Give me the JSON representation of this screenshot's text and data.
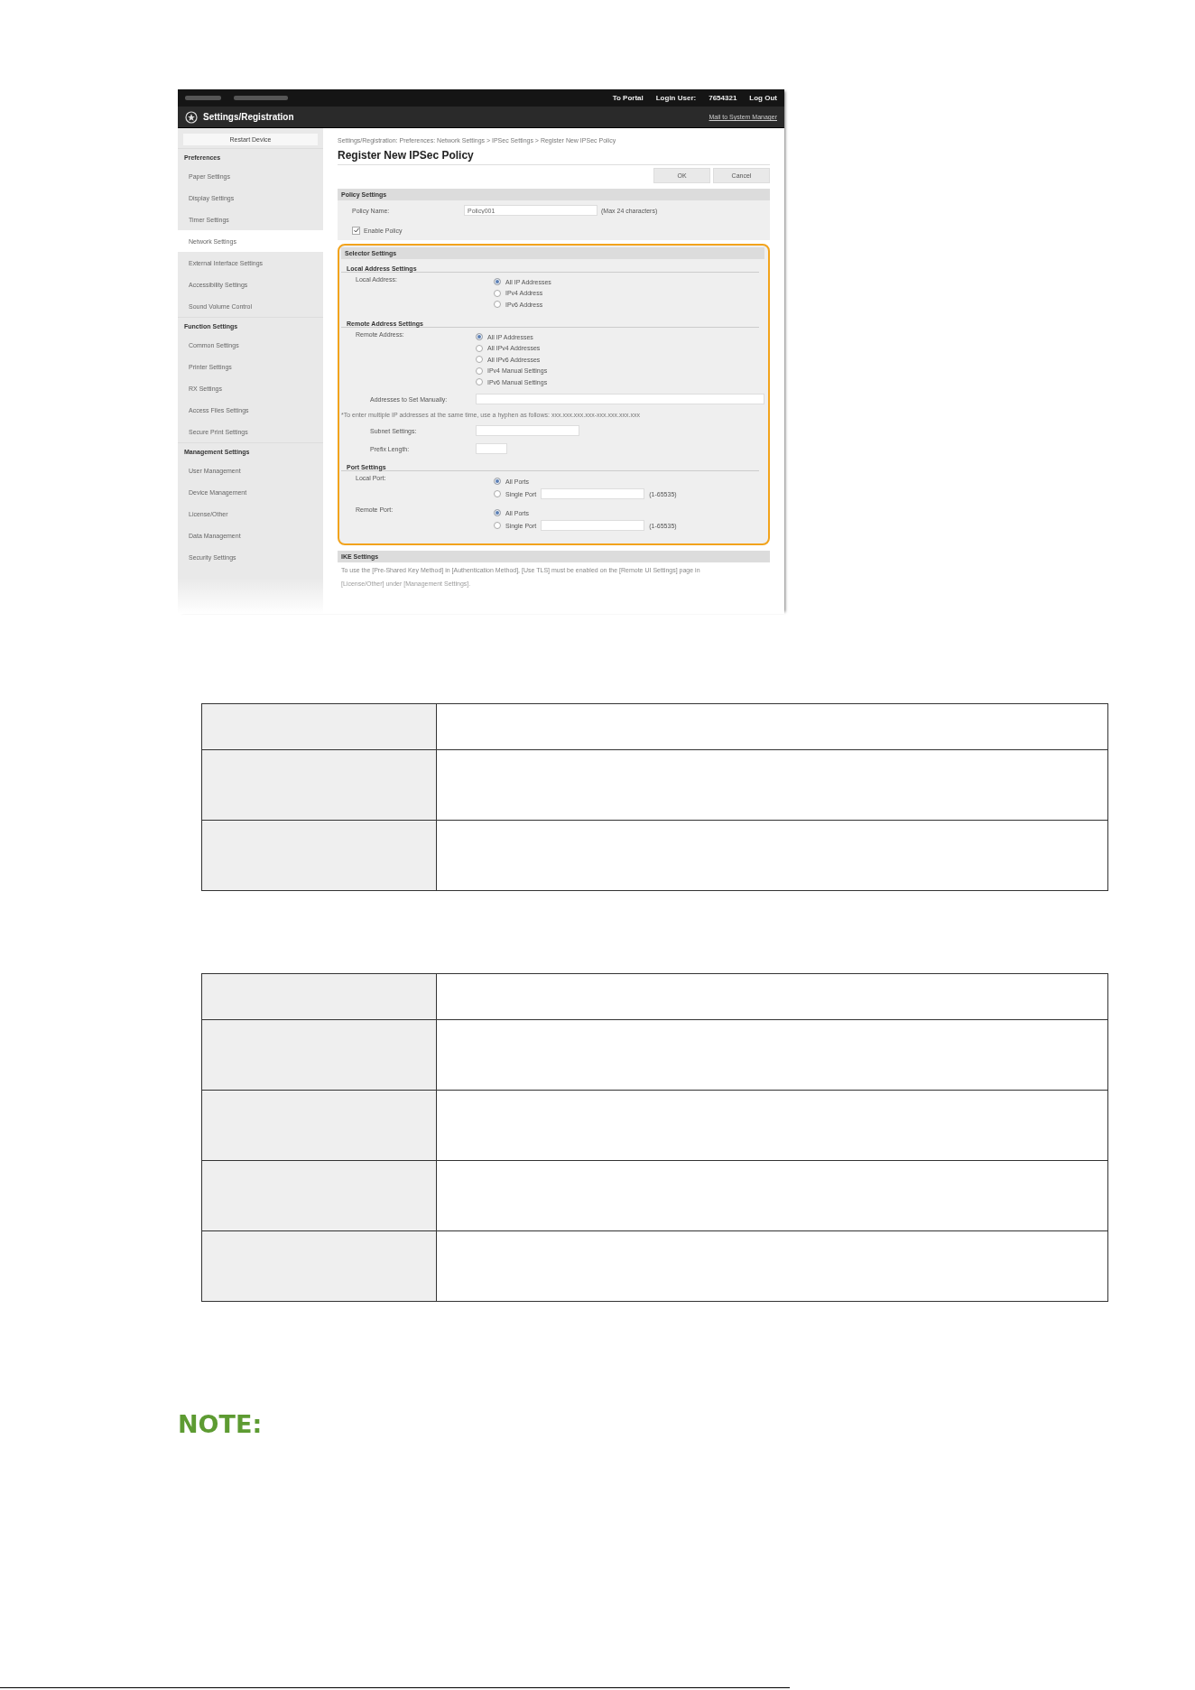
{
  "screenshot": {
    "header": {
      "portal_link": "To Portal",
      "login_label": "Login User:",
      "login_user": "7654321",
      "logout_link": "Log Out",
      "title": "Settings/Registration",
      "mail_link": "Mail to System Manager"
    },
    "sidebar": {
      "restart_button": "Restart Device",
      "sections": [
        {
          "heading": "Preferences",
          "items": [
            {
              "label": "Paper Settings",
              "selected": false
            },
            {
              "label": "Display Settings",
              "selected": false
            },
            {
              "label": "Timer Settings",
              "selected": false
            },
            {
              "label": "Network Settings",
              "selected": true
            },
            {
              "label": "External Interface Settings",
              "selected": false
            },
            {
              "label": "Accessibility Settings",
              "selected": false
            },
            {
              "label": "Sound Volume Control",
              "selected": false
            }
          ]
        },
        {
          "heading": "Function Settings",
          "items": [
            {
              "label": "Common Settings",
              "selected": false
            },
            {
              "label": "Printer Settings",
              "selected": false
            },
            {
              "label": "RX Settings",
              "selected": false
            },
            {
              "label": "Access Files Settings",
              "selected": false
            },
            {
              "label": "Secure Print Settings",
              "selected": false
            }
          ]
        },
        {
          "heading": "Management Settings",
          "items": [
            {
              "label": "User Management",
              "selected": false
            },
            {
              "label": "Device Management",
              "selected": false
            },
            {
              "label": "License/Other",
              "selected": false
            },
            {
              "label": "Data Management",
              "selected": false
            },
            {
              "label": "Security Settings",
              "selected": false
            }
          ]
        }
      ]
    },
    "breadcrumb": "Settings/Registration: Preferences: Network Settings > IPSec Settings > Register New IPSec Policy",
    "page_title": "Register New IPSec Policy",
    "buttons": [
      "OK",
      "Cancel"
    ],
    "policy_settings": {
      "heading": "Policy Settings",
      "name_label": "Policy Name:",
      "name_value": "Policy001",
      "name_hint": "(Max 24 characters)",
      "enable": {
        "label": "Enable Policy",
        "checked": true
      }
    },
    "selector_settings": {
      "heading": "Selector Settings",
      "highlighted": true,
      "local_address": {
        "heading": "Local Address Settings",
        "label": "Local Address:",
        "options": [
          {
            "label": "All IP Addresses",
            "selected": true
          },
          {
            "label": "IPv4 Address",
            "selected": false
          },
          {
            "label": "IPv6 Address",
            "selected": false
          }
        ]
      },
      "remote_address": {
        "heading": "Remote Address Settings",
        "label": "Remote Address:",
        "options": [
          {
            "label": "All IP Addresses",
            "selected": true
          },
          {
            "label": "All IPv4 Addresses",
            "selected": false
          },
          {
            "label": "All IPv6 Addresses",
            "selected": false
          },
          {
            "label": "IPv4 Manual Settings",
            "selected": false
          },
          {
            "label": "IPv6 Manual Settings",
            "selected": false
          }
        ],
        "manual_label": "Addresses to Set Manually:",
        "note": "*To enter multiple IP addresses at the same time, use a hyphen as follows: xxx.xxx.xxx.xxx-xxx.xxx.xxx.xxx",
        "subnet_label": "Subnet Settings:",
        "prefix_label": "Prefix Length:"
      },
      "port_settings": {
        "heading": "Port Settings",
        "ports": [
          {
            "label": "Local Port:",
            "options": [
              {
                "label": "All Ports",
                "selected": true
              },
              {
                "label": "Single Port",
                "selected": false
              }
            ],
            "range": "(1-65535)"
          },
          {
            "label": "Remote Port:",
            "options": [
              {
                "label": "All Ports",
                "selected": true
              },
              {
                "label": "Single Port",
                "selected": false
              }
            ],
            "range": "(1-65535)"
          }
        ]
      }
    },
    "ike_settings": {
      "heading": "IKE Settings",
      "lines": [
        "To use the [Pre-Shared Key Method] in [Authentication Method], [Use TLS] must be enabled on the [Remote UI Settings] page in",
        "[License/Other] under [Management Settings]."
      ]
    }
  },
  "tables": [
    {
      "rows": [
        {
          "kind": "short"
        },
        {
          "kind": "tall"
        },
        {
          "kind": "tall"
        }
      ]
    },
    {
      "rows": [
        {
          "kind": "short"
        },
        {
          "kind": "tall"
        },
        {
          "kind": "tall"
        },
        {
          "kind": "tall"
        },
        {
          "kind": "tall"
        }
      ]
    }
  ],
  "note": {
    "heading": "NOTE:"
  }
}
